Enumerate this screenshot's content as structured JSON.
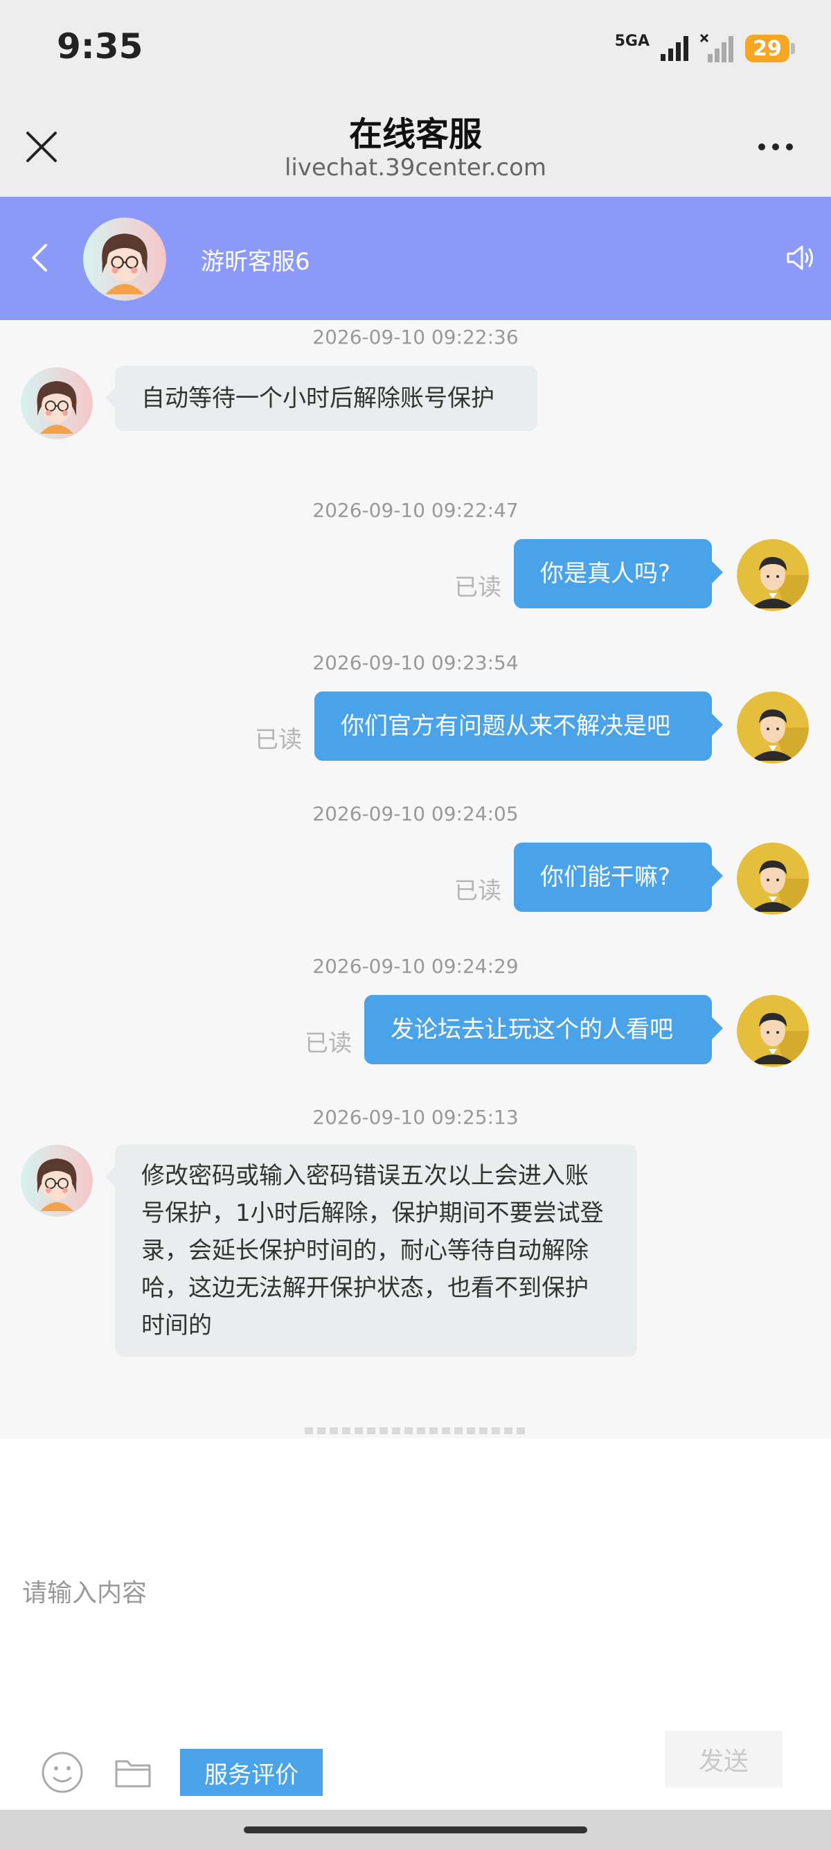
{
  "status_bar": {
    "time": "9:35",
    "network": "5GA",
    "battery": "29",
    "battery_color": "#f5a623"
  },
  "browser": {
    "title": "在线客服",
    "url": "livechat.39center.com",
    "close_icon": "close-icon",
    "more_icon": "more-icon"
  },
  "chat_header": {
    "agent_name": "游昕客服6",
    "background": "#8b9af8"
  },
  "messages": [
    {
      "timestamp": "2026-09-10 09:22:36",
      "from": "agent",
      "text": "自动等待一个小时后解除账号保护"
    },
    {
      "timestamp": "2026-09-10 09:22:47",
      "from": "user",
      "text": "你是真人吗?",
      "status": "已读"
    },
    {
      "timestamp": "2026-09-10 09:23:54",
      "from": "user",
      "text": "你们官方有问题从来不解决是吧",
      "status": "已读"
    },
    {
      "timestamp": "2026-09-10 09:24:05",
      "from": "user",
      "text": "你们能干嘛?",
      "status": "已读"
    },
    {
      "timestamp": "2026-09-10 09:24:29",
      "from": "user",
      "text": "发论坛去让玩这个的人看吧",
      "status": "已读"
    },
    {
      "timestamp": "2026-09-10 09:25:13",
      "from": "agent",
      "text": "修改密码或输入密码错误五次以上会进入账号保护，1小时后解除，保护期间不要尝试登录，会延长保护时间的，耐心等待自动解除哈，这边无法解开保护状态，也看不到保护时间的"
    }
  ],
  "input": {
    "placeholder": "请输入内容",
    "rate_label": "服务评价",
    "send_label": "发送"
  },
  "colors": {
    "user_bubble": "#4aa3e8",
    "agent_bubble": "#e9eded"
  }
}
